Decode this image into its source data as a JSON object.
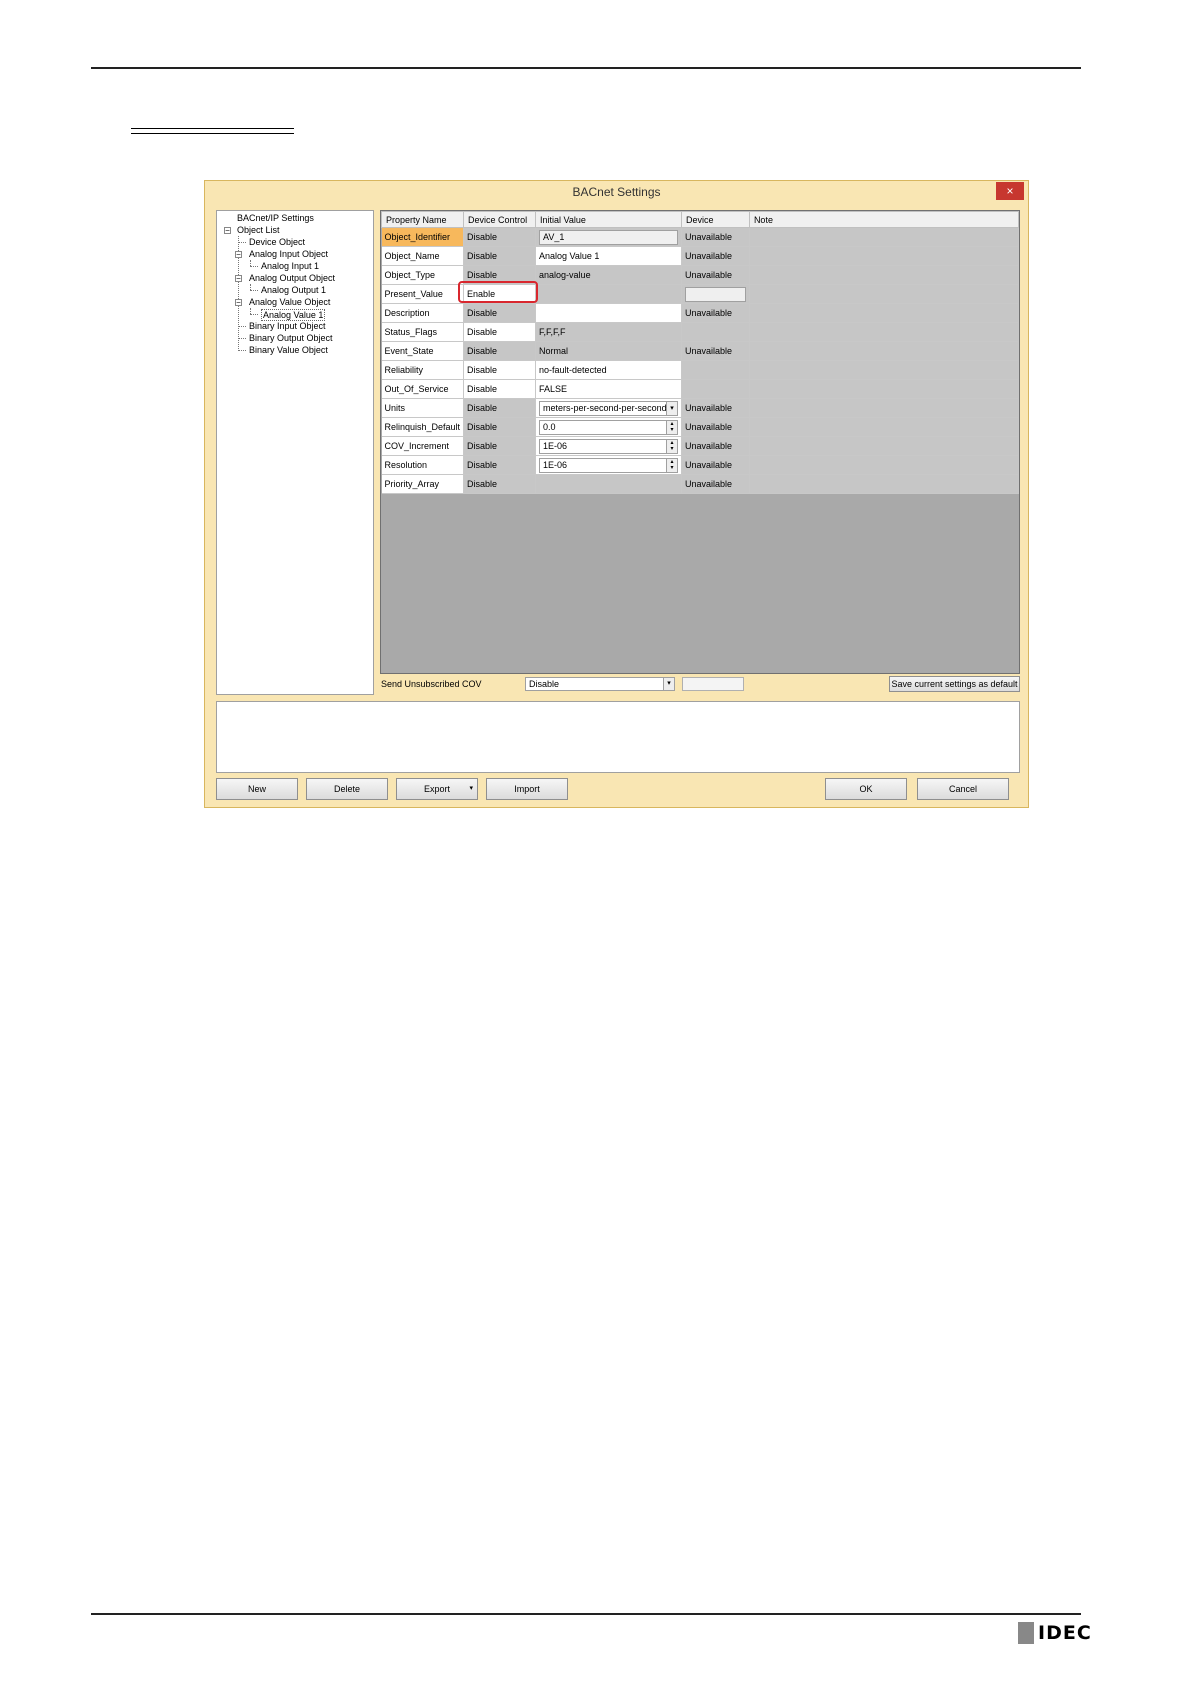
{
  "dialog": {
    "title": "BACnet Settings",
    "close_glyph": "×"
  },
  "tree": {
    "items": [
      {
        "label": "BACnet/IP Settings"
      },
      {
        "label": "Object List"
      },
      {
        "label": "Device Object"
      },
      {
        "label": "Analog Input Object"
      },
      {
        "label": "Analog Input 1"
      },
      {
        "label": "Analog Output Object"
      },
      {
        "label": "Analog Output 1"
      },
      {
        "label": "Analog Value Object"
      },
      {
        "label": "Analog Value 1"
      },
      {
        "label": "Binary Input Object"
      },
      {
        "label": "Binary Output Object"
      },
      {
        "label": "Binary Value Object"
      }
    ],
    "expander_glyph": "−"
  },
  "grid": {
    "headers": {
      "name": "Property Name",
      "control": "Device Control",
      "initial": "Initial Value",
      "device": "Device",
      "note": "Note"
    },
    "rows": [
      {
        "name": "Object_Identifier",
        "control": "Disable",
        "initial": "AV_1",
        "device": "Unavailable"
      },
      {
        "name": "Object_Name",
        "control": "Disable",
        "initial": "Analog Value 1",
        "device": "Unavailable"
      },
      {
        "name": "Object_Type",
        "control": "Disable",
        "initial": "analog-value",
        "device": "Unavailable"
      },
      {
        "name": "Present_Value",
        "control": "Enable",
        "initial": "",
        "device": ""
      },
      {
        "name": "Description",
        "control": "Disable",
        "initial": "",
        "device": "Unavailable"
      },
      {
        "name": "Status_Flags",
        "control": "Disable",
        "initial": "F,F,F,F",
        "device": ""
      },
      {
        "name": "Event_State",
        "control": "Disable",
        "initial": "Normal",
        "device": "Unavailable"
      },
      {
        "name": "Reliability",
        "control": "Disable",
        "initial": "no-fault-detected",
        "device": ""
      },
      {
        "name": "Out_Of_Service",
        "control": "Disable",
        "initial": "FALSE",
        "device": ""
      },
      {
        "name": "Units",
        "control": "Disable",
        "initial": "meters-per-second-per-second",
        "device": "Unavailable"
      },
      {
        "name": "Relinquish_Default",
        "control": "Disable",
        "initial": "0.0",
        "device": "Unavailable"
      },
      {
        "name": "COV_Increment",
        "control": "Disable",
        "initial": "1E-06",
        "device": "Unavailable"
      },
      {
        "name": "Resolution",
        "control": "Disable",
        "initial": "1E-06",
        "device": "Unavailable"
      },
      {
        "name": "Priority_Array",
        "control": "Disable",
        "initial": "",
        "device": "Unavailable"
      }
    ],
    "combo_glyph": "▾",
    "spin_up": "▴",
    "spin_down": "▾"
  },
  "cov": {
    "label": "Send Unsubscribed COV",
    "value": "Disable"
  },
  "buttons": {
    "save_default": "Save current settings as default",
    "new": "New",
    "delete": "Delete",
    "export": "Export",
    "import": "Import",
    "ok": "OK",
    "cancel": "Cancel"
  },
  "footer": {
    "logo": "IDEC"
  },
  "colors": {
    "dialog_bg": "#f9e6b3",
    "selected_cell": "#f7b85c",
    "highlight": "#d9272e",
    "close": "#c7372f"
  }
}
